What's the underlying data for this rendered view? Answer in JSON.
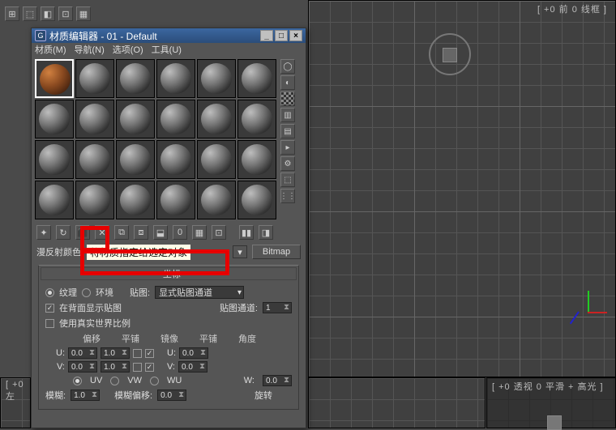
{
  "viewports": {
    "top_right_label": "[ +0 前 0 线框 ]",
    "bottom_left_label": "[ +0 左",
    "bottom_right_label": "[ +0 透视 0 平滑 + 高光 ]"
  },
  "me": {
    "title": "材质编辑器 - 01 - Default",
    "menu_material": "材质(M)",
    "menu_nav": "导航(N)",
    "menu_options": "选项(O)",
    "menu_tools": "工具(U)",
    "section_label": "漫反射颜色",
    "tooltip": "将材质指定给选定对象",
    "bitmap_btn": "Bitmap",
    "rollout_title": "坐标",
    "radio_texture": "纹理",
    "radio_env": "环境",
    "map_label": "贴图:",
    "map_dd": "显式贴图通道",
    "show_back": "在背面显示贴图",
    "map_channel_label": "贴图通道:",
    "map_channel_val": "1",
    "real_world": "使用真实世界比例",
    "hdr_offset": "偏移",
    "hdr_tile": "平铺",
    "hdr_mirror": "镜像",
    "hdr_tile2": "平铺",
    "hdr_angle": "角度",
    "u_label": "U:",
    "v_label": "V:",
    "w_label": "W:",
    "u_off": "0.0",
    "u_tile": "1.0",
    "u_ang": "0.0",
    "v_off": "0.0",
    "v_tile": "1.0",
    "v_ang": "0.0",
    "w_ang": "0.0",
    "uv_uv": "UV",
    "uv_vw": "VW",
    "uv_wu": "WU",
    "blur_label": "模糊:",
    "blur_val": "1.0",
    "blur_off_label": "模糊偏移:",
    "blur_off_val": "0.0",
    "rotate_btn": "旋转"
  }
}
